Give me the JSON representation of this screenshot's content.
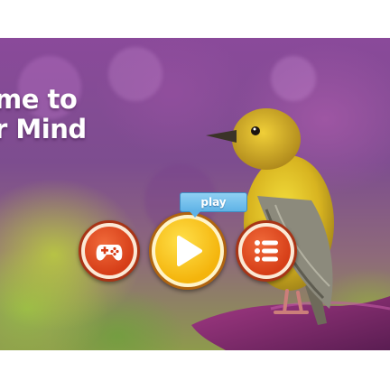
{
  "title": {
    "lines": "me to\nr Mind"
  },
  "buttons": {
    "games_icon": "gamepad-icon",
    "play_icon": "play-icon",
    "menu_icon": "list-icon"
  },
  "tooltip": {
    "label": "play"
  },
  "colors": {
    "play_yellow": "#f4b40c",
    "side_red": "#d63e18",
    "tooltip_blue": "#5fb3e6",
    "button_border": "#a83416"
  }
}
